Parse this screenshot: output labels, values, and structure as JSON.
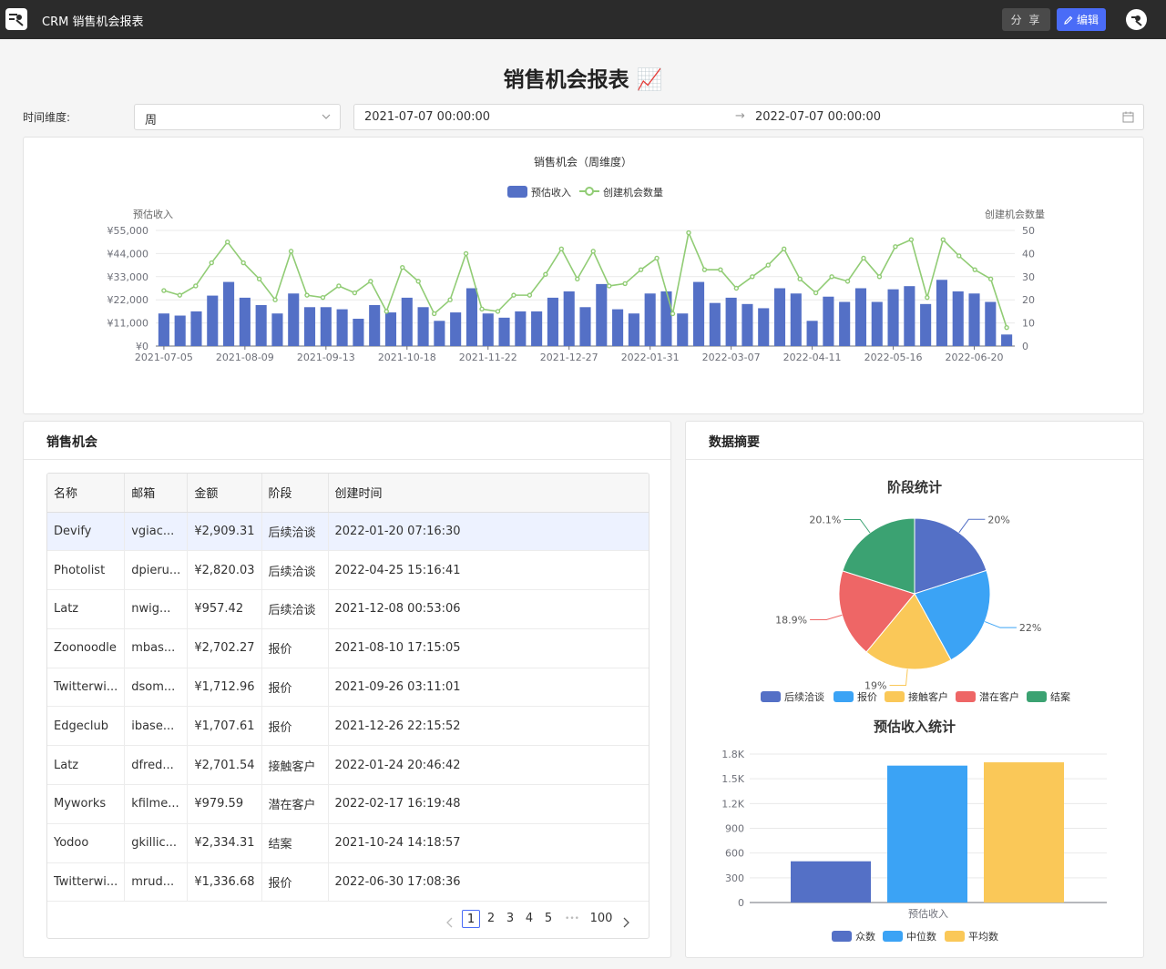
{
  "app": {
    "title": "CRM 销售机会报表",
    "share_label": "分 享",
    "edit_label": "编辑"
  },
  "page": {
    "title": "销售机会报表 📈"
  },
  "filters": {
    "time_label": "时间维度:",
    "granularity": "周",
    "date_start": "2021-07-07 00:00:00",
    "date_end": "2022-07-07 00:00:00",
    "range_sep": "→"
  },
  "main_chart": {
    "title": "销售机会（周维度）",
    "legend_bar": "预估收入",
    "legend_line": "创建机会数量",
    "y_left_label": "预估收入",
    "y_right_label": "创建机会数量",
    "y_left_ticks": [
      "¥0",
      "¥11,000",
      "¥22,000",
      "¥33,000",
      "¥44,000",
      "¥55,000"
    ],
    "y_right_ticks": [
      "0",
      "10",
      "20",
      "30",
      "40",
      "50"
    ],
    "x_ticks": [
      "2021-07-05",
      "2021-08-09",
      "2021-09-13",
      "2021-10-18",
      "2021-11-22",
      "2021-12-27",
      "2022-01-31",
      "2022-03-07",
      "2022-04-11",
      "2022-05-16",
      "2022-06-20"
    ]
  },
  "table_card": {
    "title": "销售机会",
    "columns": [
      "名称",
      "邮箱",
      "金额",
      "阶段",
      "创建时间"
    ],
    "rows": [
      [
        "Devify",
        "vgiac...",
        "¥2,909.31",
        "后续洽谈",
        "2022-01-20 07:16:30"
      ],
      [
        "Photolist",
        "dpieru...",
        "¥2,820.03",
        "后续洽谈",
        "2022-04-25 15:16:41"
      ],
      [
        "Latz",
        "nwig...",
        "¥957.42",
        "后续洽谈",
        "2021-12-08 00:53:06"
      ],
      [
        "Zoonoodle",
        "mbas...",
        "¥2,702.27",
        "报价",
        "2021-08-10 17:15:05"
      ],
      [
        "Twitterwi...",
        "dsom...",
        "¥1,712.96",
        "报价",
        "2021-09-26 03:11:01"
      ],
      [
        "Edgeclub",
        "ibase...",
        "¥1,707.61",
        "报价",
        "2021-12-26 22:15:52"
      ],
      [
        "Latz",
        "dfred...",
        "¥2,701.54",
        "接触客户",
        "2022-01-24 20:46:42"
      ],
      [
        "Myworks",
        "kfilme...",
        "¥979.59",
        "潜在客户",
        "2022-02-17 16:19:48"
      ],
      [
        "Yodoo",
        "gkillic...",
        "¥2,334.31",
        "结案",
        "2021-10-24 14:18:57"
      ],
      [
        "Twitterwi...",
        "mrud...",
        "¥1,336.68",
        "报价",
        "2022-06-30 17:08:36"
      ]
    ],
    "pager": {
      "pages": [
        "1",
        "2",
        "3",
        "4",
        "5"
      ],
      "ellipsis": "•••",
      "last": "100",
      "current": "1"
    }
  },
  "summary_card": {
    "title": "数据摘要"
  },
  "chart_data": [
    {
      "type": "bar+line",
      "title": "销售机会（周维度）",
      "x_ticks": [
        "2021-07-05",
        "2021-08-09",
        "2021-09-13",
        "2021-10-18",
        "2021-11-22",
        "2021-12-27",
        "2022-01-31",
        "2022-03-07",
        "2022-04-11",
        "2022-05-16",
        "2022-06-20"
      ],
      "series": [
        {
          "name": "预估收入",
          "type": "bar",
          "axis": "left",
          "values": [
            15500,
            14500,
            16500,
            24000,
            30500,
            23000,
            19500,
            15500,
            25000,
            18500,
            18500,
            17500,
            13000,
            19500,
            16000,
            23000,
            18500,
            12000,
            16000,
            27500,
            15500,
            13500,
            16500,
            16500,
            23000,
            26000,
            18500,
            29500,
            17500,
            15500,
            25000,
            26000,
            15500,
            30500,
            20500,
            23000,
            20000,
            18000,
            27500,
            25000,
            12000,
            23500,
            21000,
            27500,
            21000,
            27000,
            28500,
            20000,
            31500,
            26000,
            25000,
            21000,
            5500
          ]
        },
        {
          "name": "创建机会数量",
          "type": "line",
          "axis": "right",
          "values": [
            24,
            22,
            26,
            36,
            45,
            36,
            29,
            20,
            41,
            22,
            21,
            26,
            23,
            28,
            15,
            34,
            28,
            14,
            20,
            40,
            16,
            15,
            22,
            22,
            31,
            42,
            29,
            41,
            26,
            27,
            33,
            38,
            14,
            49,
            33,
            33,
            25,
            30,
            35,
            42,
            29,
            23,
            30,
            28,
            38,
            30,
            43,
            46,
            21,
            46,
            39,
            33,
            29,
            8
          ]
        }
      ],
      "ylim_left": [
        0,
        55000
      ],
      "ylim_right": [
        0,
        50
      ],
      "legend": "top-center"
    },
    {
      "type": "pie",
      "title": "阶段统计",
      "slices": [
        {
          "name": "后续洽谈",
          "value": 20,
          "label": "20%",
          "color": "#5470c6"
        },
        {
          "name": "报价",
          "value": 22,
          "label": "22%",
          "color": "#3ba3f5"
        },
        {
          "name": "接触客户",
          "value": 19,
          "label": "19%",
          "color": "#fac858"
        },
        {
          "name": "潜在客户",
          "value": 18.9,
          "label": "18.9%",
          "color": "#ee6666"
        },
        {
          "name": "结案",
          "value": 20.1,
          "label": "20.1%",
          "color": "#3ba272"
        }
      ],
      "legend": "bottom"
    },
    {
      "type": "bar",
      "title": "预估收入统计",
      "categories": [
        "预估收入"
      ],
      "series": [
        {
          "name": "众数",
          "values": [
            500
          ],
          "color": "#5470c6"
        },
        {
          "name": "中位数",
          "values": [
            1660
          ],
          "color": "#3ba3f5"
        },
        {
          "name": "平均数",
          "values": [
            1700
          ],
          "color": "#fac858"
        }
      ],
      "y_ticks": [
        "0",
        "300",
        "600",
        "900",
        "1.2K",
        "1.5K",
        "1.8K"
      ],
      "ylim": [
        0,
        1800
      ],
      "legend": "bottom"
    }
  ]
}
